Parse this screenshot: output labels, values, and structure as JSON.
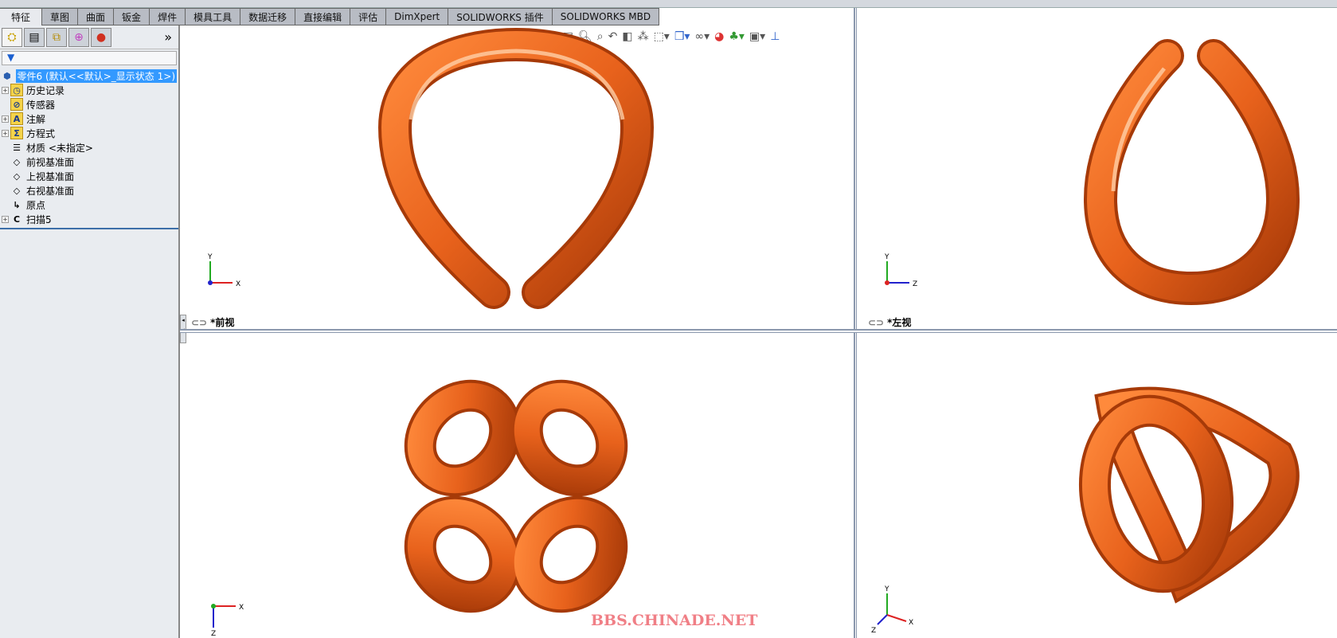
{
  "tabs": [
    "特征",
    "草图",
    "曲面",
    "钣金",
    "焊件",
    "模具工具",
    "数据迁移",
    "直接编辑",
    "评估",
    "DimXpert",
    "SOLIDWORKS 插件",
    "SOLIDWORKS MBD"
  ],
  "active_tab": "特征",
  "panel": {
    "more": "»",
    "filter_icon": "funnel-icon",
    "root": "零件6  (默认<<默认>_显示状态 1>)",
    "items": [
      {
        "label": "历史记录",
        "icon": "history-icon",
        "expand": true,
        "glyph": "◷"
      },
      {
        "label": "传感器",
        "icon": "sensor-icon",
        "expand": false,
        "glyph": "⊘"
      },
      {
        "label": "注解",
        "icon": "annotation-icon",
        "expand": true,
        "glyph": "A"
      },
      {
        "label": "方程式",
        "icon": "equation-icon",
        "expand": true,
        "glyph": "Σ"
      },
      {
        "label": "材质 <未指定>",
        "icon": "material-icon",
        "expand": false,
        "glyph": "☰"
      },
      {
        "label": "前视基准面",
        "icon": "plane-icon",
        "expand": false,
        "glyph": "◇"
      },
      {
        "label": "上视基准面",
        "icon": "plane-icon",
        "expand": false,
        "glyph": "◇"
      },
      {
        "label": "右视基准面",
        "icon": "plane-icon",
        "expand": false,
        "glyph": "◇"
      },
      {
        "label": "原点",
        "icon": "origin-icon",
        "expand": false,
        "glyph": "↳"
      },
      {
        "label": "扫描5",
        "icon": "sweep-icon",
        "expand": true,
        "glyph": "C"
      }
    ]
  },
  "views": {
    "front": "*前视",
    "left": "*左视"
  },
  "axes": {
    "x": "X",
    "y": "Y",
    "z": "Z"
  },
  "watermark": "BBS.CHINADE.NET",
  "colors": {
    "tube": "#e8621c",
    "highlight": "#3399ff"
  }
}
